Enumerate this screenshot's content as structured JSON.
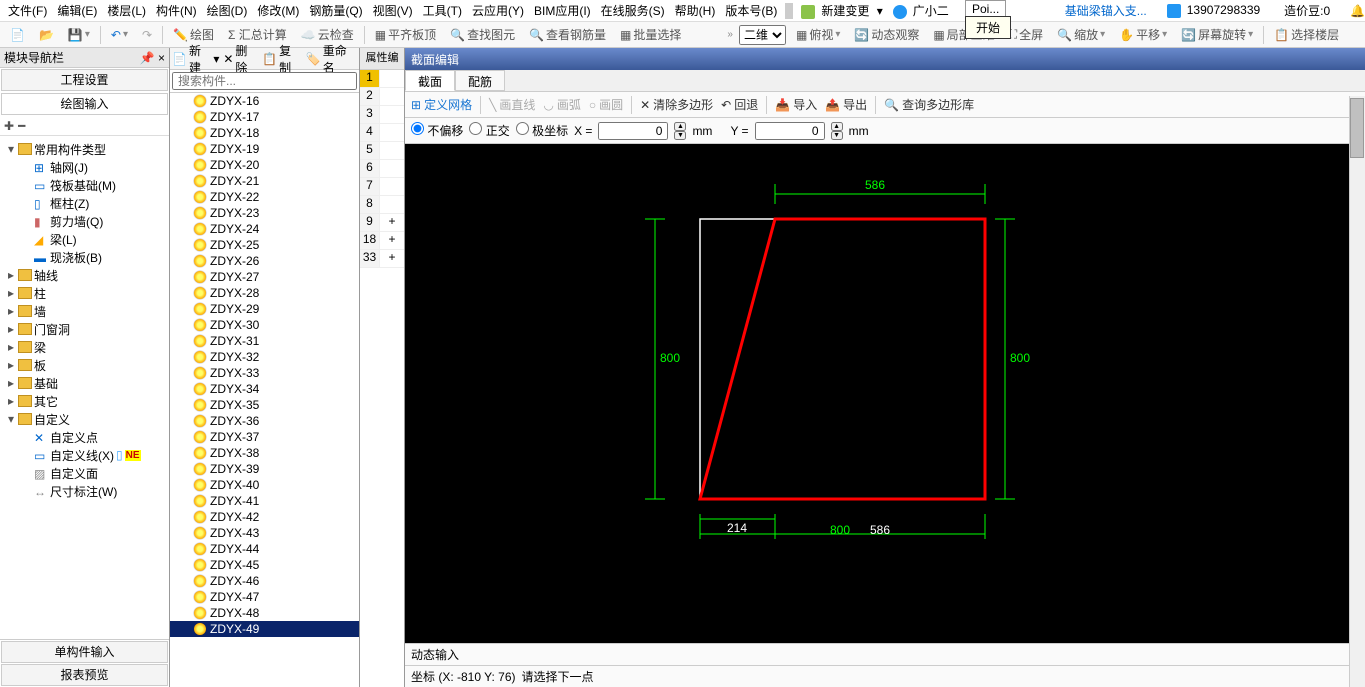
{
  "menu": {
    "file": "文件(F)",
    "edit": "编辑(E)",
    "floor": "楼层(L)",
    "component": "构件(N)",
    "draw": "绘图(D)",
    "modify": "修改(M)",
    "rebar": "钢筋量(Q)",
    "view": "视图(V)",
    "tool": "工具(T)",
    "cloud": "云应用(Y)",
    "bim": "BIM应用(I)",
    "online": "在线服务(S)",
    "help": "帮助(H)",
    "version": "版本号(B)",
    "newchange": "新建变更",
    "gxe": "广小二",
    "link": "基础梁锚入支...",
    "user": "13907298339",
    "cost": "造价豆:0"
  },
  "tooltip": {
    "t1": "Poi...",
    "t2": "开始"
  },
  "toolbar2": {
    "draw": "绘图",
    "sum": "Σ 汇总计算",
    "cloud": "云检查",
    "level": "平齐板顶",
    "find": "查找图元",
    "rebar": "查看钢筋量",
    "batch": "批量选择",
    "dim": "二维",
    "topview": "俯视",
    "dynamic": "动态观察",
    "local3d": "局部三维",
    "fullscreen": "全屏",
    "zoom": "缩放",
    "pan": "平移",
    "rotate": "屏幕旋转",
    "selfloor": "选择楼层"
  },
  "leftpane": {
    "title": "模块导航栏",
    "tab1": "工程设置",
    "tab2": "绘图输入",
    "btab1": "单构件输入",
    "btab2": "报表预览"
  },
  "tree": {
    "root": "常用构件类型",
    "axis": "轴网(J)",
    "raft": "筏板基础(M)",
    "col": "框柱(Z)",
    "shear": "剪力墙(Q)",
    "beam": "梁(L)",
    "slab": "现浇板(B)",
    "axisline": "轴线",
    "zhu": "柱",
    "qiang": "墙",
    "door": "门窗洞",
    "liang": "梁",
    "ban": "板",
    "jichu": "基础",
    "other": "其它",
    "custom": "自定义",
    "cpoint": "自定义点",
    "cline": "自定义线(X)",
    "cface": "自定义面",
    "dim": "尺寸标注(W)"
  },
  "midtoolbar": {
    "new": "新建",
    "del": "删除",
    "copy": "复制",
    "rename": "重命名"
  },
  "search_placeholder": "搜索构件...",
  "complist": [
    "ZDYX-16",
    "ZDYX-17",
    "ZDYX-18",
    "ZDYX-19",
    "ZDYX-20",
    "ZDYX-21",
    "ZDYX-22",
    "ZDYX-23",
    "ZDYX-24",
    "ZDYX-25",
    "ZDYX-26",
    "ZDYX-27",
    "ZDYX-28",
    "ZDYX-29",
    "ZDYX-30",
    "ZDYX-31",
    "ZDYX-32",
    "ZDYX-33",
    "ZDYX-34",
    "ZDYX-35",
    "ZDYX-36",
    "ZDYX-37",
    "ZDYX-38",
    "ZDYX-39",
    "ZDYX-40",
    "ZDYX-41",
    "ZDYX-42",
    "ZDYX-43",
    "ZDYX-44",
    "ZDYX-45",
    "ZDYX-46",
    "ZDYX-47",
    "ZDYX-48",
    "ZDYX-49"
  ],
  "narrow": {
    "hdr": "属性编",
    "rows": [
      1,
      2,
      3,
      4,
      5,
      6,
      7,
      8,
      9,
      18,
      33
    ]
  },
  "right": {
    "title": "截面编辑",
    "tab1": "截面",
    "tab2": "配筋",
    "grid": "定义网格",
    "line": "画直线",
    "arc": "画弧",
    "circle": "画圆",
    "clear": "清除多边形",
    "undo": "回退",
    "import": "导入",
    "export": "导出",
    "query": "查询多边形库",
    "nooffset": "不偏移",
    "ortho": "正交",
    "polar": "极坐标",
    "x": "X =",
    "y": "Y =",
    "mm": "mm",
    "xval": "0",
    "yval": "0"
  },
  "canvas_dims": {
    "top": "586",
    "left": "800",
    "right": "800",
    "bot1": "214",
    "bot2": "800",
    "bot3": "586"
  },
  "status": {
    "dyn": "动态输入",
    "coord": "坐标 (X: -810 Y: 76)",
    "prompt": "请选择下一点"
  }
}
